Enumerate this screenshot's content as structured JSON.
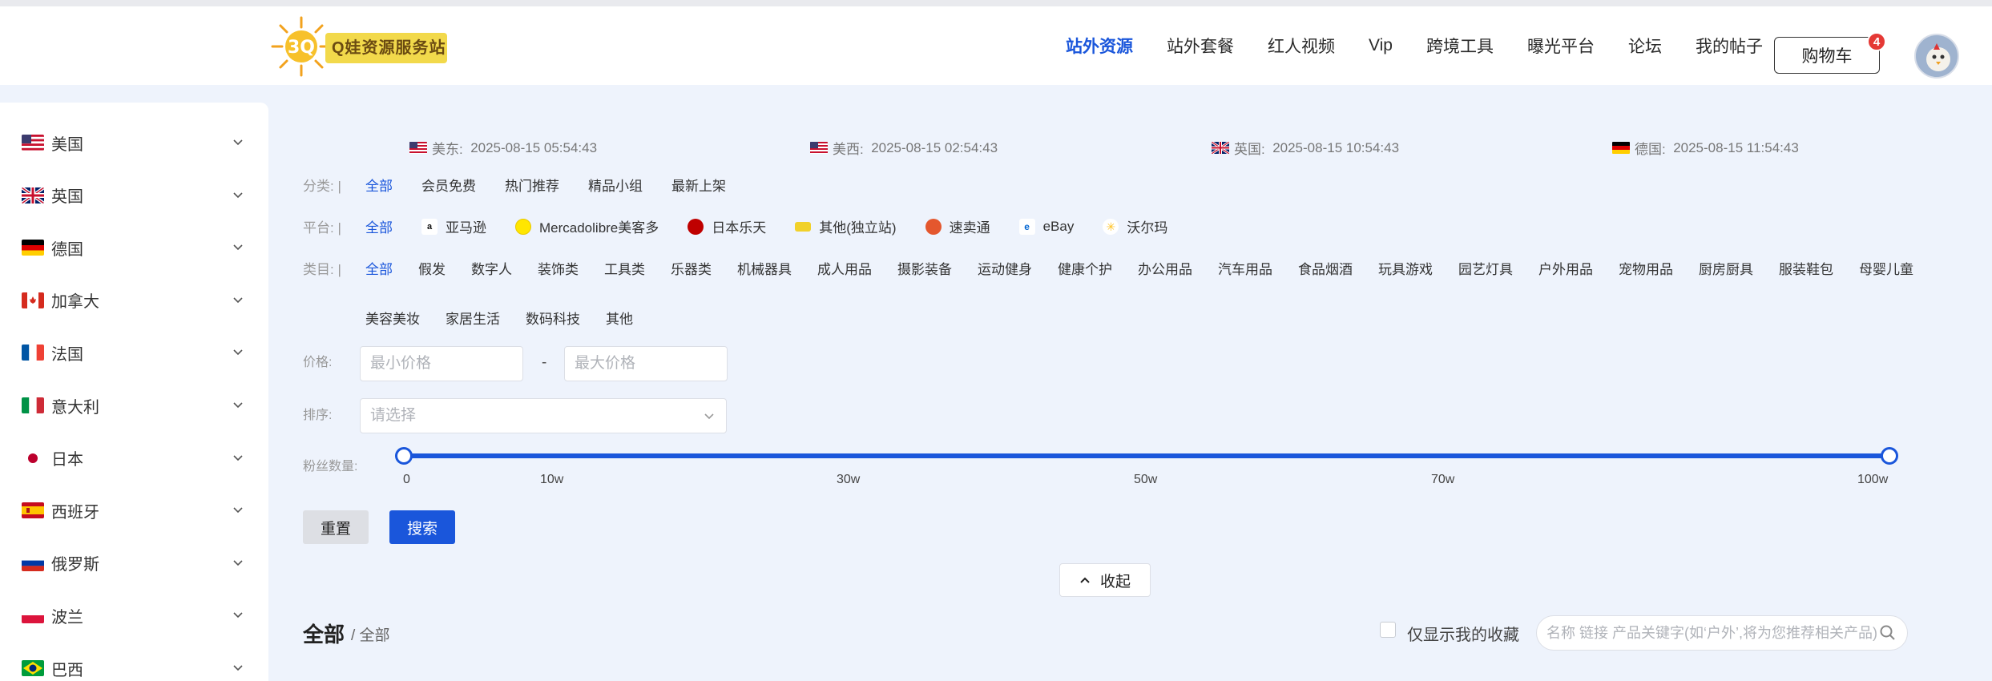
{
  "brand": {
    "logo_text": "Q娃资源服务站",
    "logo_mark": "3Q"
  },
  "nav": {
    "items": [
      {
        "label": "站外资源",
        "active": true
      },
      {
        "label": "站外套餐",
        "active": false
      },
      {
        "label": "红人视频",
        "active": false
      },
      {
        "label": "Vip",
        "active": false
      },
      {
        "label": "跨境工具",
        "active": false
      },
      {
        "label": "曝光平台",
        "active": false
      },
      {
        "label": "论坛",
        "active": false
      },
      {
        "label": "我的帖子",
        "active": false
      }
    ],
    "cart_label": "购物车",
    "cart_count": "4"
  },
  "sidebar": {
    "items": [
      {
        "label": "美国",
        "flag": "us"
      },
      {
        "label": "英国",
        "flag": "uk"
      },
      {
        "label": "德国",
        "flag": "de"
      },
      {
        "label": "加拿大",
        "flag": "ca"
      },
      {
        "label": "法国",
        "flag": "fr"
      },
      {
        "label": "意大利",
        "flag": "it"
      },
      {
        "label": "日本",
        "flag": "jp"
      },
      {
        "label": "西班牙",
        "flag": "es"
      },
      {
        "label": "俄罗斯",
        "flag": "ru"
      },
      {
        "label": "波兰",
        "flag": "pl"
      },
      {
        "label": "巴西",
        "flag": "br"
      }
    ]
  },
  "times": [
    {
      "label": "美东:",
      "value": "2025-08-15 05:54:43",
      "flag": "us"
    },
    {
      "label": "美西:",
      "value": "2025-08-15 02:54:43",
      "flag": "us"
    },
    {
      "label": "英国:",
      "value": "2025-08-15 10:54:43",
      "flag": "uk"
    },
    {
      "label": "德国:",
      "value": "2025-08-15 11:54:43",
      "flag": "de"
    }
  ],
  "filters": {
    "category": {
      "key": "分类: |",
      "options": [
        "全部",
        "会员免费",
        "热门推荐",
        "精品小组",
        "最新上架"
      ]
    },
    "platform": {
      "key": "平台: |",
      "options": [
        "全部",
        "亚马逊",
        "Mercadolibre美客多",
        "日本乐天",
        "其他(独立站)",
        "速卖通",
        "eBay",
        "沃尔玛"
      ]
    },
    "type": {
      "key": "类目: |",
      "options_row1": [
        "全部",
        "假发",
        "数字人",
        "装饰类",
        "工具类",
        "乐器类",
        "机械器具",
        "成人用品",
        "摄影装备",
        "运动健身",
        "健康个护",
        "办公用品",
        "汽车用品",
        "食品烟酒",
        "玩具游戏",
        "园艺灯具",
        "户外用品",
        "宠物用品",
        "厨房厨具",
        "服装鞋包",
        "母婴儿童"
      ],
      "options_row2": [
        "美容美妆",
        "家居生活",
        "数码科技",
        "其他"
      ]
    }
  },
  "price": {
    "label": "价格:",
    "min_placeholder": "最小价格",
    "max_placeholder": "最大价格",
    "separator": "-"
  },
  "sort": {
    "label": "排序:",
    "placeholder": "请选择"
  },
  "fans": {
    "label": "粉丝数量:",
    "ticks": [
      "0",
      "10w",
      "30w",
      "50w",
      "70w",
      "100w"
    ],
    "range_min_fraction": 0,
    "range_max_fraction": 1
  },
  "actions": {
    "reset": "重置",
    "search": "搜索",
    "collapse": "收起"
  },
  "results": {
    "title": "全部",
    "crumb": "/ 全部",
    "fav_label": "仅显示我的收藏",
    "keyword_placeholder": "名称 链接 产品关键字(如‘户外’,将为您推荐相关产品)"
  },
  "colors": {
    "accent": "#1a56db",
    "badge": "#e53935",
    "bg": "#eef3fc"
  }
}
